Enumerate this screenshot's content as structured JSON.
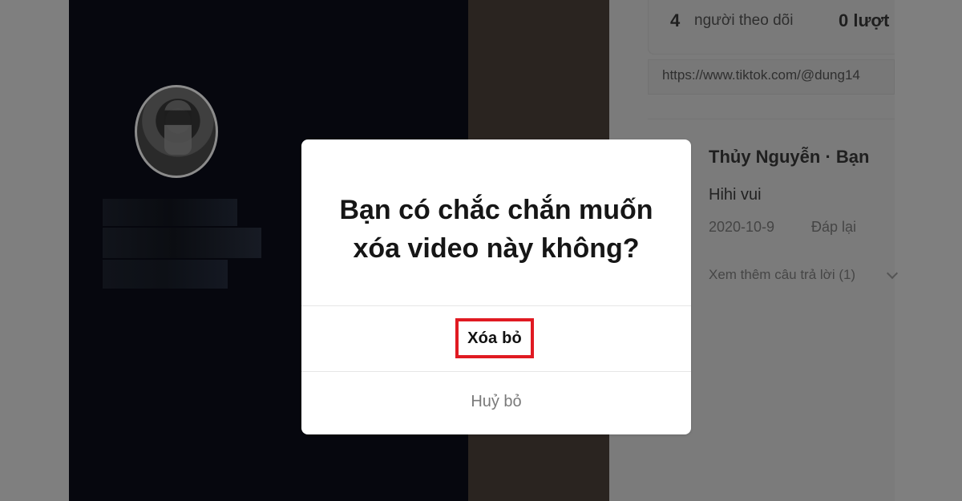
{
  "page": {
    "stats": {
      "followers_count": "4",
      "followers_label": "người theo dõi",
      "likes_count": "0 lượt"
    },
    "profile_url": "https://www.tiktok.com/@dung14",
    "comment": {
      "author": "Thủy Nguyễn · Bạn",
      "text": "Hihi vui",
      "date": "2020-10-9",
      "reply_label": "Đáp lại",
      "more_replies": "Xem thêm câu trả lời (1)"
    },
    "dialog": {
      "title": "Bạn có chắc chắn muốn xóa video này không?",
      "delete_label": "Xóa bỏ",
      "cancel_label": "Huỷ bỏ"
    }
  }
}
